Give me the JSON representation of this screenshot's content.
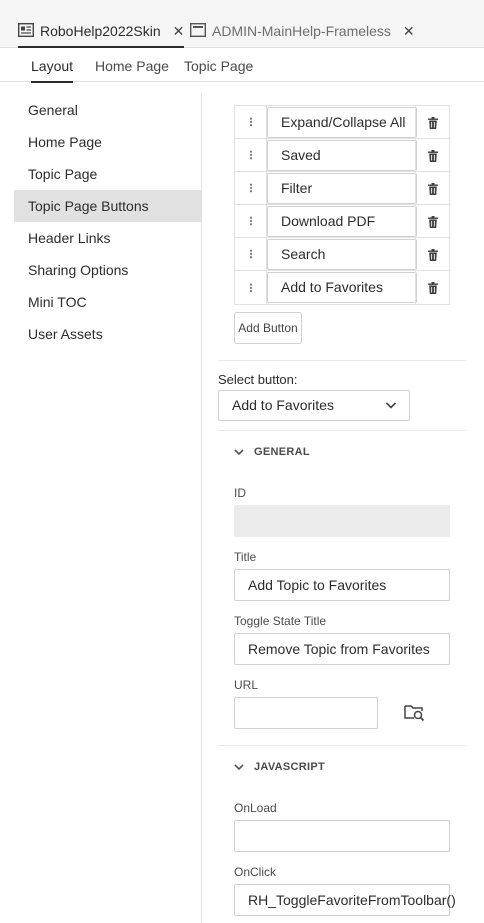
{
  "doc_tabs": [
    {
      "label": "RoboHelp2022Skin",
      "close": "✕"
    },
    {
      "label": "ADMIN-MainHelp-Frameless",
      "close": "✕"
    }
  ],
  "sub_tabs": [
    "Layout",
    "Home Page",
    "Topic Page"
  ],
  "sidebar": {
    "items": [
      {
        "label": "General"
      },
      {
        "label": "Home Page"
      },
      {
        "label": "Topic Page"
      },
      {
        "label": "Topic Page Buttons"
      },
      {
        "label": "Header Links"
      },
      {
        "label": "Sharing Options"
      },
      {
        "label": "Mini TOC"
      },
      {
        "label": "User Assets"
      }
    ],
    "active": "Topic Page Buttons"
  },
  "buttons": {
    "items": [
      "Expand/Collapse All",
      "Saved",
      "Filter",
      "Download PDF",
      "Search",
      "Add to Favorites"
    ],
    "add_label": "Add Button"
  },
  "select_button": {
    "label": "Select button:",
    "value": "Add to Favorites"
  },
  "general": {
    "heading": "GENERAL",
    "id_label": "ID",
    "id_value": "",
    "title_label": "Title",
    "title_value": "Add Topic to Favorites",
    "toggle_label": "Toggle State Title",
    "toggle_value": "Remove Topic from Favorites",
    "url_label": "URL",
    "url_value": ""
  },
  "javascript": {
    "heading": "JAVASCRIPT",
    "onload_label": "OnLoad",
    "onload_value": "",
    "onclick_label": "OnClick",
    "onclick_value": "RH_ToggleFavoriteFromToolbar()"
  }
}
